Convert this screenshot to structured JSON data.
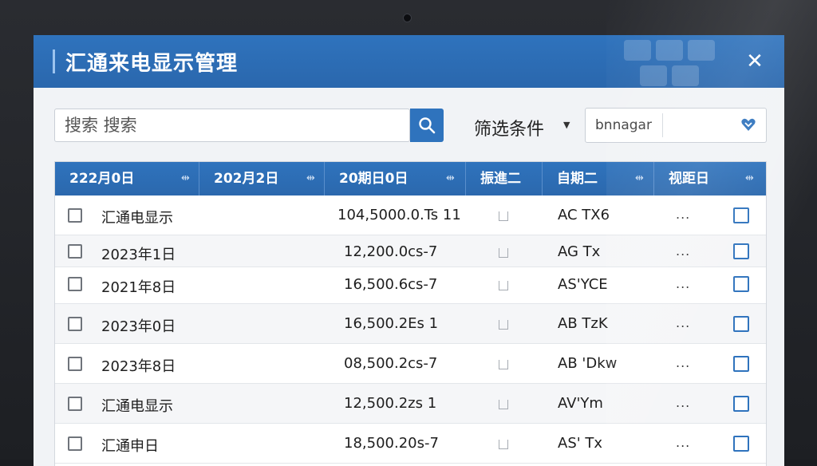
{
  "window": {
    "title": "汇通来电显示管理"
  },
  "search": {
    "placeholder": "搜索 搜索",
    "button_icon": "search-icon"
  },
  "filter": {
    "label": "筛选条件",
    "selected_value": "bnnagar"
  },
  "colors": {
    "accent": "#2f73bd",
    "header_text": "#ffffff"
  },
  "table": {
    "columns": [
      "222月0日",
      "202月2日",
      "20期日0日",
      "振進二",
      "自期二",
      "视距日"
    ],
    "rows": [
      {
        "name": "汇通电显示",
        "amount": "104,5000.0.Ts 11",
        "code": "AC TX6"
      },
      {
        "name": "2023年1日",
        "amount": "12,200.0cs-7",
        "code": "AG Tx"
      },
      {
        "name": "2021年8日",
        "amount": "16,500.6cs-7",
        "code": "AS'YCE"
      },
      {
        "name": "2023年0日",
        "amount": "16,500.2Es 1",
        "code": "AB TzK"
      },
      {
        "name": "2023年8日",
        "amount": "08,500.2cs-7",
        "code": "AB 'Dkw"
      },
      {
        "name": "汇通电显示",
        "amount": "12,500.2zs 1",
        "code": "AV'Ym"
      },
      {
        "name": "汇通申日",
        "amount": "18,500.20s-7",
        "code": "AS' Tx"
      }
    ],
    "more_label": "..."
  }
}
